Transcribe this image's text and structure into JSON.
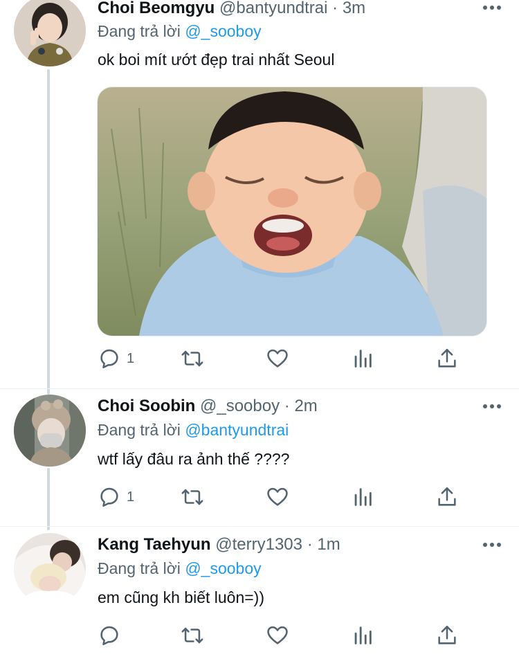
{
  "tweets": [
    {
      "name": "Choi Beomgyu",
      "handle": "@bantyundtrai",
      "separator": "·",
      "time": "3m",
      "reply_prefix": "Đang trả lời",
      "reply_to": "@_sooboy",
      "text": "ok boi mít ướt đẹp trai nhất Seoul",
      "has_media": true,
      "reply_count": "1"
    },
    {
      "name": "Choi Soobin",
      "handle": "@_sooboy",
      "separator": "·",
      "time": "2m",
      "reply_prefix": "Đang trả lời",
      "reply_to": "@bantyundtrai",
      "text": "wtf lấy đâu ra ảnh thế ????",
      "reply_count": "1"
    },
    {
      "name": "Kang Taehyun",
      "handle": "@terry1303",
      "separator": "·",
      "time": "1m",
      "reply_prefix": "Đang trả lời",
      "reply_to": "@_sooboy",
      "text": "em cũng kh biết luôn=))",
      "reply_count": ""
    }
  ],
  "icons": [
    "reply-icon",
    "retweet-icon",
    "like-icon",
    "analytics-icon",
    "share-icon",
    "more-icon"
  ],
  "colors": {
    "accent": "#1d9bf0",
    "secondary": "#536471",
    "thread": "#cfd9de"
  }
}
